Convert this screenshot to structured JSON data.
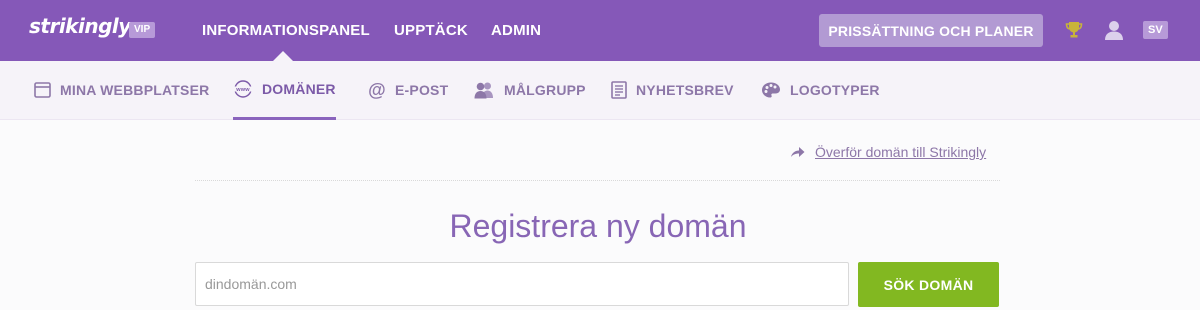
{
  "brand": {
    "logo": "strikingly",
    "badge": "VIP"
  },
  "main_nav": [
    {
      "label": "INFORMATIONSPANEL"
    },
    {
      "label": "UPPTÄCK"
    },
    {
      "label": "ADMIN"
    }
  ],
  "header_right": {
    "pricing_label": "PRISSÄTTNING OCH PLANER",
    "trophy_icon": "trophy-icon",
    "user_icon": "user-icon",
    "language": "SV"
  },
  "sub_nav": [
    {
      "label": "MINA WEBBPLATSER",
      "icon": "browser-window-icon"
    },
    {
      "label": "DOMÄNER",
      "icon": "www-globe-icon",
      "active": true
    },
    {
      "label": "E-POST",
      "icon": "at-sign-icon"
    },
    {
      "label": "MÅLGRUPP",
      "icon": "people-icon"
    },
    {
      "label": "NYHETSBREV",
      "icon": "newsletter-icon"
    },
    {
      "label": "LOGOTYPER",
      "icon": "palette-icon"
    }
  ],
  "main": {
    "transfer_link": "Överför domän till Strikingly",
    "title": "Registrera ny domän",
    "search_placeholder": "dindomän.com",
    "search_button": "SÖK DOMÄN"
  },
  "colors": {
    "topbar": "#8558b8",
    "subbar": "#f6f3f9",
    "accent_text": "#8866b5",
    "button_green": "#82b821"
  }
}
